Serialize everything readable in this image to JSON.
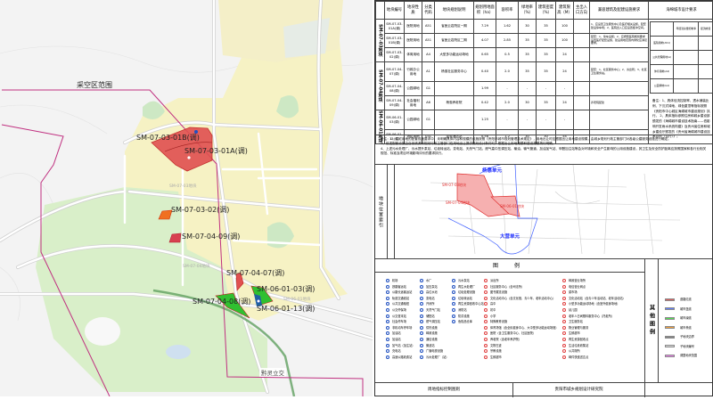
{
  "map": {
    "boundary_label": "采空区范围",
    "plots": [
      {
        "label": "SM-07-03-01B(调)",
        "color": "#e05050"
      },
      {
        "label": "SM-07-03-01A(调)",
        "color": "#e05050"
      },
      {
        "label": "SM-07-03-02(调)",
        "color": "#f07020"
      },
      {
        "label": "SM-07-04-09(调)",
        "color": "#d84050"
      },
      {
        "label": "SM-07-04-07(调)",
        "color": "#e05050"
      },
      {
        "label": "SM-06-01-03(调)",
        "color": "#30c030"
      },
      {
        "label": "SM-07-04-08(调)",
        "color": "#30c030"
      },
      {
        "label": "SM-06-01-13(调)",
        "color": "#2060a0"
      }
    ],
    "area_labels": [
      "SM-07-03地块",
      "SM-07-04地块",
      "SM-06-01地块"
    ],
    "road_chars": [
      "北",
      "大",
      "道",
      "大",
      "营",
      "马",
      "南",
      "花",
      "山",
      "路",
      "黔灵立交"
    ],
    "boundary_color": "#c03080"
  },
  "table": {
    "headers": [
      "地块编号",
      "地块性质",
      "分类代码",
      "地块规划说明",
      "规划用地面积（ha）",
      "容积率",
      "绿地率（%）",
      "建筑密度（%）",
      "建筑限高（M）",
      "主出入口方向",
      "兼容建筑及配建设施要求",
      "海绵城市设计要求"
    ],
    "groups": [
      {
        "name": "SM-07-03地块",
        "rows": [
          [
            "SM-07-03-01A(调)",
            "医院用地",
            "A51",
            "省医云岩院区一期",
            "7.29",
            "1.62",
            "30",
            "35",
            "100",
            ""
          ],
          [
            "SM-07-03-01B(调)",
            "医院用地",
            "A51",
            "省医云岩院区二期",
            "4.07",
            "2.85",
            "35",
            "35",
            "100",
            ""
          ],
          [
            "SM-07-03-02(调)",
            "体育用地",
            "A4",
            "大型多功能运动场地",
            "0.65",
            "0.5",
            "35",
            "35",
            "24",
            ""
          ]
        ]
      },
      {
        "name": "SM-07-04地块",
        "rows": [
          [
            "SM-07-04-07(调)",
            "行政办公用地",
            "A1",
            "杨惠社区服务中心",
            "0.40",
            "2.0",
            "35",
            "35",
            "24",
            ""
          ],
          [
            "SM-07-04-08(调)",
            "公园绿地",
            "G1",
            "",
            "1.99",
            "-",
            "-",
            "-",
            "-",
            ""
          ],
          [
            "SM-07-04-09(调)",
            "社会福利用地",
            "A6",
            "杨惠养老院",
            "0.42",
            "2.0",
            "30",
            "35",
            "24",
            ""
          ]
        ]
      },
      {
        "name": "SM-06-01地块",
        "rows": [
          [
            "SM-06-01-03(调)",
            "公园绿地",
            "G1",
            "",
            "1.25",
            "-",
            "-",
            "-",
            "-",
            ""
          ],
          [
            "SM-06-01-13(调)",
            "消防用地",
            "U31",
            "金惠消防站",
            "0.58",
            "1.2",
            "30",
            "30",
            "54",
            ""
          ]
        ]
      }
    ],
    "compat": [
      "1、应设置卫生服务中心及医疗相关设施，配套建设停车场；2、医院出入口应设置缓冲空间。",
      "配套：1、停车设施；2、应按照医院规划要求设置医疗配套设施，建设用地范围内绿化应满足要求。",
      "配套：1、社区服务中心；2、派出所；3、社区卫生服务站。",
      "养老院配建"
    ],
    "sponge_sub": {
      "headers": [
        "年径流总量控制率",
        "径流峰值"
      ],
      "rows": [
        "医院用地(A51)",
        "公共管理用地(A)",
        "体育用地(A4)",
        "公园绿地(G1)"
      ]
    },
    "sponge_note": "备注：1、具体径流控制率、透水铺装比例、下沉式绿地、绿色屋顶等指标按照《贵阳市中心城区海绵城市建设规划》执行。 2、具体指标参照住房和城乡建设部颁发的《海绵城市建设技术指南——低影响开发雨水系统构建》及贵州省住房和城乡建设厅颁发的《贵州省海绵城市建设技术导则（试行）》。"
  },
  "notes": [
    "备注：1、住宅用地的配套设施要求中，未明确具体内容和规模的设施按照《贵阳市城市规划管理技术规定》，用地出让时应根据出让用地建设规模，由城乡规划行政主管部门对各级公建服务设施进行确定。",
    "3、前述配套设施由自然资源和规划行政主管部门在用地出让提供规划设计条件时，根据出让用地规模和建设规模再行明确。",
    "4、上述污水处理厂、污水提升泵站、垃圾转运站、变电站、天然气门站、燃气高中压调压站、输油、输气管道、加油加气站、甲醛加注站等会对环境和安全产生影响的公用设施建设，其卫生及安全防护距离应按照国家和各行业相关规范、标准及项目环境影响评价的要求执行。"
  ],
  "location": {
    "title": "地块位置索引",
    "units": [
      "杨惠单元",
      "大营单元"
    ],
    "plots": [
      "SM-07-03地块",
      "SM-07-04地块",
      "SM-06-01地块"
    ]
  },
  "legend": {
    "title": "图 例",
    "columns": [
      [
        "机场",
        "铁路客运站",
        "公路长途客运站",
        "轨道交通线站",
        "公共交通枢纽",
        "公交停保场",
        "公交首末站",
        "社会停车场",
        "非机动车停车场",
        "加油站",
        "加油站",
        "加气站（加注站）",
        "充电站",
        "高速公路收费站"
      ],
      [
        "水厂",
        "加压泵站",
        "高位水池",
        "变电站",
        "开闭所",
        "天然气门站",
        "储配站",
        "燃气调压站",
        "供热设施",
        "邮政设施",
        "通信设施",
        "微波站",
        "广播电视设施",
        "污水处理厂（站）"
      ],
      [
        "污水泵站",
        "再生水处理厂",
        "垃圾处理设施",
        "垃圾转运站",
        "再生资源回收中心站",
        "消防站",
        "防洪设施",
        "危险品仓库"
      ],
      [
        "派出所",
        "社区服务中心（含司法所）",
        "图书展览设施",
        "文化活动中心（含文化馆、青少年、老年活动中心）",
        "高中",
        "初中",
        "小学",
        "特殊教育设施",
        "体育场馆（含全民健身中心、大中型多功能运动场馆）",
        "医院（含卫生服务中心、社区医院）",
        "养老院（含老年养护院）",
        "文物古迹",
        "宗教设施",
        "生鲜超市"
      ],
      [
        "邮政营业场所",
        "电信营业网点",
        "菜市场",
        "文化活动站（含青少年活动站、老年活动站）",
        "小型多功能运动场地（含室外健身场地）",
        "幼儿园",
        "老年人日间照料服务中心（托老所）",
        "卫生服务站",
        "物业管理与服务",
        "生鲜超市",
        "再生资源回收点",
        "生活垃圾收集站",
        "公共厕所",
        "邮件快递送达点"
      ]
    ],
    "column_colors": [
      "#2050c0",
      "#2050c0",
      "#2050c0",
      "#e04040",
      "#e04040"
    ]
  },
  "other_legend": {
    "title": "其他图例",
    "items": [
      {
        "label": "道路红线",
        "color": "#e06060"
      },
      {
        "label": "城市蓝线",
        "color": "#6080ff"
      },
      {
        "label": "城市绿线",
        "color": "#50e050"
      },
      {
        "label": "城市黄线",
        "color": "#f0a040"
      },
      {
        "label": "子地块边界",
        "color": "#888888"
      },
      {
        "label": "子地块编号",
        "color": "#dddddd"
      },
      {
        "label": "调整地块范围",
        "color": "#f080f0"
      }
    ]
  },
  "footer": {
    "left": "周地指标控制图则",
    "right": "贵阳市城乡规划设计研究院"
  }
}
